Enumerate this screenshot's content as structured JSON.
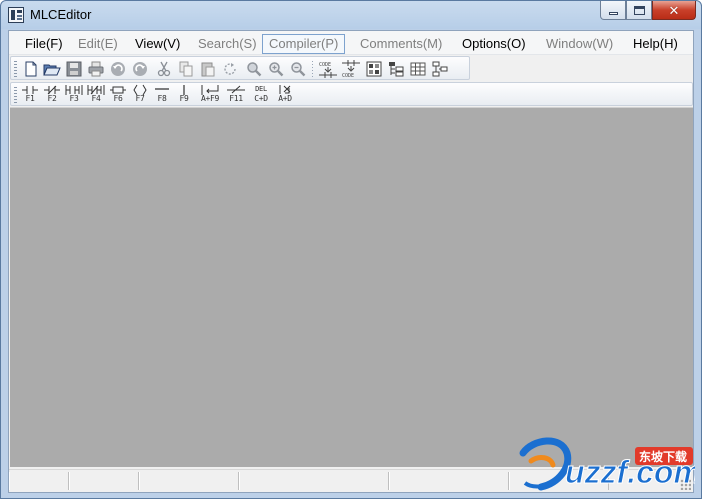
{
  "window": {
    "title": "MLCEditor",
    "close_glyph": "✕"
  },
  "menubar": {
    "items": [
      {
        "label": "File(F)",
        "state": "enabled"
      },
      {
        "label": "Edit(E)",
        "state": "disabled"
      },
      {
        "label": "View(V)",
        "state": "enabled"
      },
      {
        "label": "Search(S)",
        "state": "disabled"
      },
      {
        "label": "Compiler(P)",
        "state": "hover"
      },
      {
        "label": "Comments(M)",
        "state": "disabled"
      },
      {
        "label": "Options(O)",
        "state": "enabled"
      },
      {
        "label": "Window(W)",
        "state": "disabled"
      },
      {
        "label": "Help(H)",
        "state": "enabled"
      }
    ]
  },
  "toolbar_main": {
    "icons": [
      "new-file-icon",
      "open-folder-icon",
      "save-icon",
      "print-icon",
      "undo-icon",
      "redo-icon",
      "cut-icon",
      "copy-icon",
      "paste-icon",
      "refresh-icon",
      "find-icon",
      "zoom-in-icon",
      "zoom-out-icon",
      "code-to-ladder-icon",
      "ladder-to-code-icon",
      "device-list-icon",
      "tree-view-icon",
      "grid-table-icon",
      "network-icon"
    ]
  },
  "toolbar_ladder": {
    "keys": [
      {
        "label": "F1",
        "icon": "normally-open-contact-icon"
      },
      {
        "label": "F2",
        "icon": "normally-closed-contact-icon"
      },
      {
        "label": "F3",
        "icon": "parallel-open-contact-icon"
      },
      {
        "label": "F4",
        "icon": "parallel-closed-contact-icon"
      },
      {
        "label": "F6",
        "icon": "output-coil-icon"
      },
      {
        "label": "F7",
        "icon": "function-block-icon"
      },
      {
        "label": "F8",
        "icon": "horizontal-line-icon"
      },
      {
        "label": "F9",
        "icon": "vertical-line-icon"
      },
      {
        "label": "A+F9",
        "icon": "delete-vertical-line-icon"
      },
      {
        "label": "F11",
        "icon": "invert-icon"
      },
      {
        "label": "C+D",
        "icon": "delete-line-icon",
        "top_text": "DEL"
      },
      {
        "label": "A+D",
        "icon": "delete-column-icon"
      }
    ]
  },
  "watermark": {
    "text": "uzzf.com",
    "cn_text": "东坡下载",
    "colors": {
      "blue": "#1b6fd0",
      "orange": "#f08a1c",
      "red": "#e23a2a"
    }
  }
}
